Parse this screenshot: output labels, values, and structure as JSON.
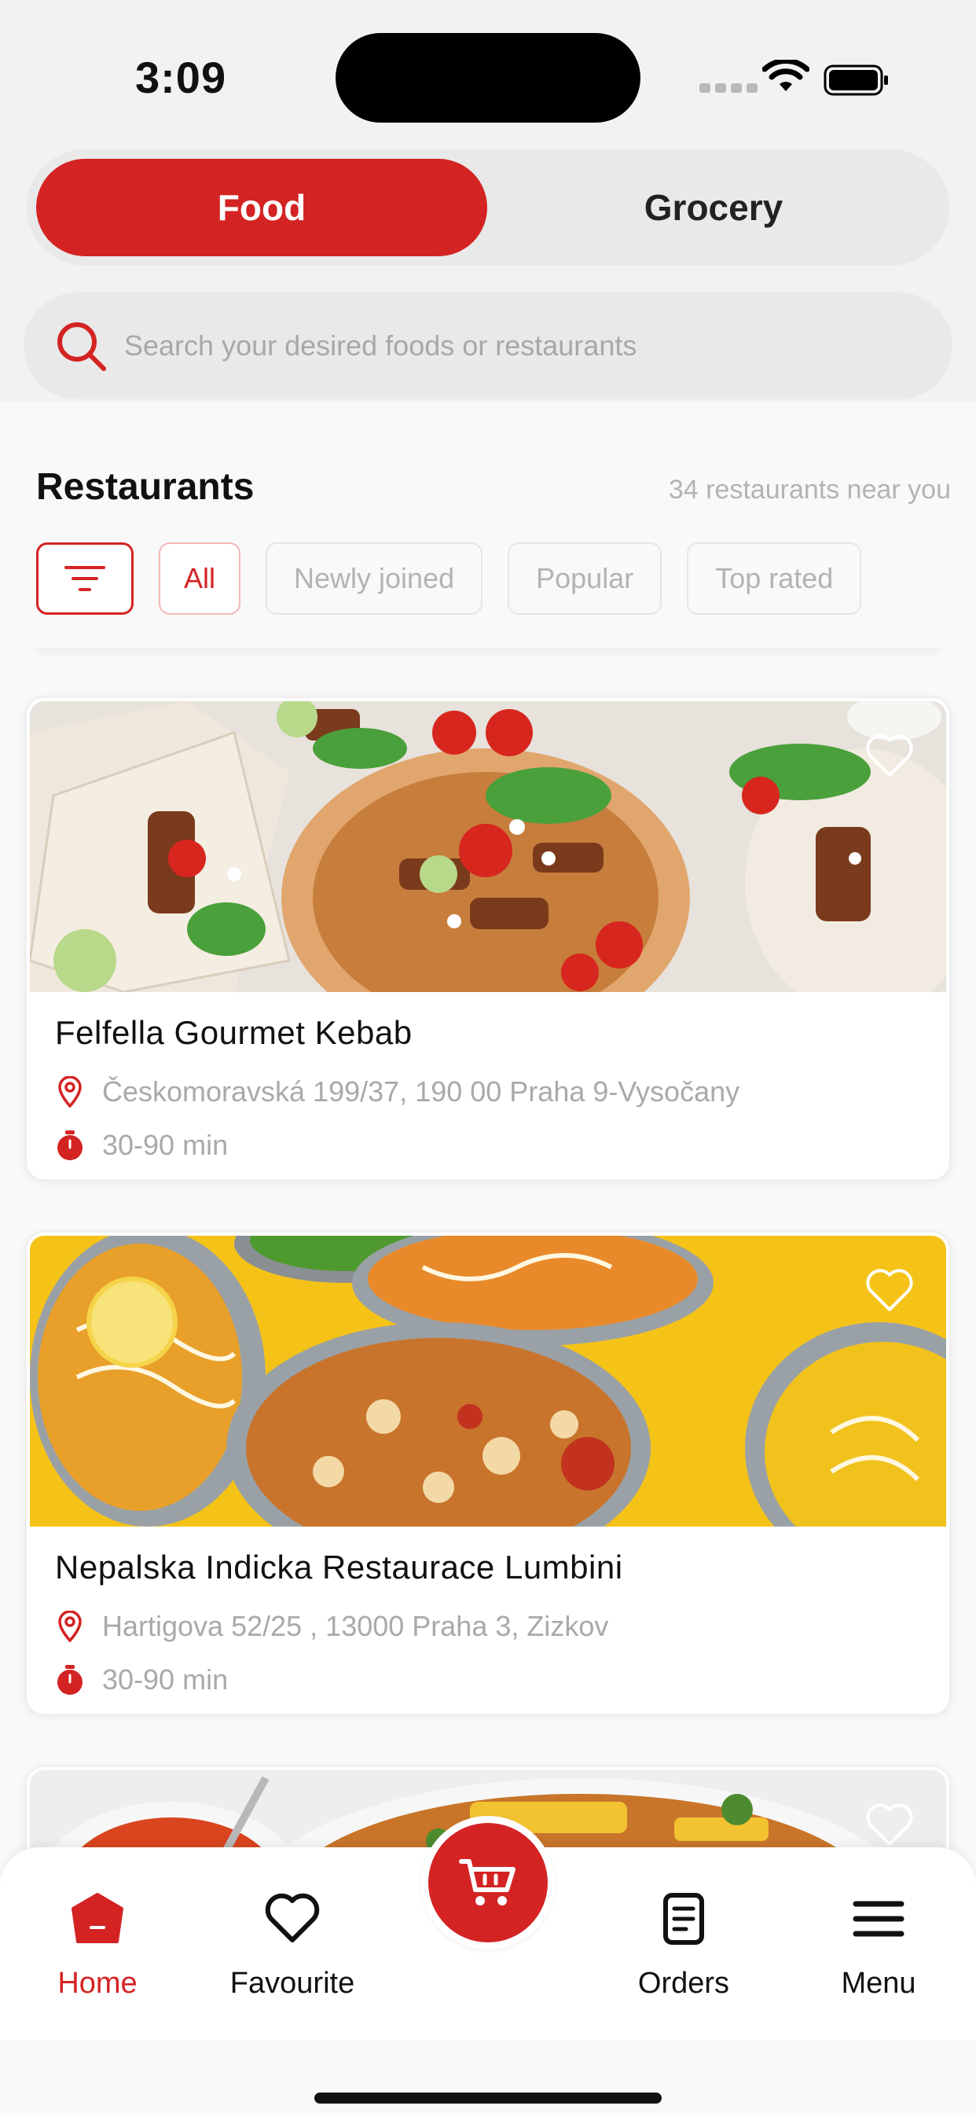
{
  "status_bar": {
    "time": "3:09"
  },
  "tabs": [
    {
      "label": "Food",
      "active": true
    },
    {
      "label": "Grocery",
      "active": false
    }
  ],
  "search": {
    "placeholder": "Search your desired foods or restaurants"
  },
  "section": {
    "title": "Restaurants",
    "count_text": "34 restaurants near you"
  },
  "filters": {
    "icon": "filter-icon",
    "chips": [
      {
        "label": "All",
        "active": true
      },
      {
        "label": "Newly joined",
        "active": false
      },
      {
        "label": "Popular",
        "active": false
      },
      {
        "label": "Top rated",
        "active": false
      }
    ]
  },
  "restaurants": [
    {
      "name": "Felfella Gourmet Kebab",
      "address": "Českomoravská 199/37, 190 00 Praha 9-Vysočany",
      "time": "30-90 min"
    },
    {
      "name": "Nepalska Indicka Restaurace Lumbini",
      "address": "Hartigova 52/25 , 13000 Praha 3, Zizkov",
      "time": "30-90 min"
    }
  ],
  "bottom_nav": {
    "home": "Home",
    "favourite": "Favourite",
    "orders": "Orders",
    "menu": "Menu",
    "cart_icon": "cart-icon"
  },
  "colors": {
    "accent": "#d42323",
    "muted": "#a9a9a9"
  }
}
